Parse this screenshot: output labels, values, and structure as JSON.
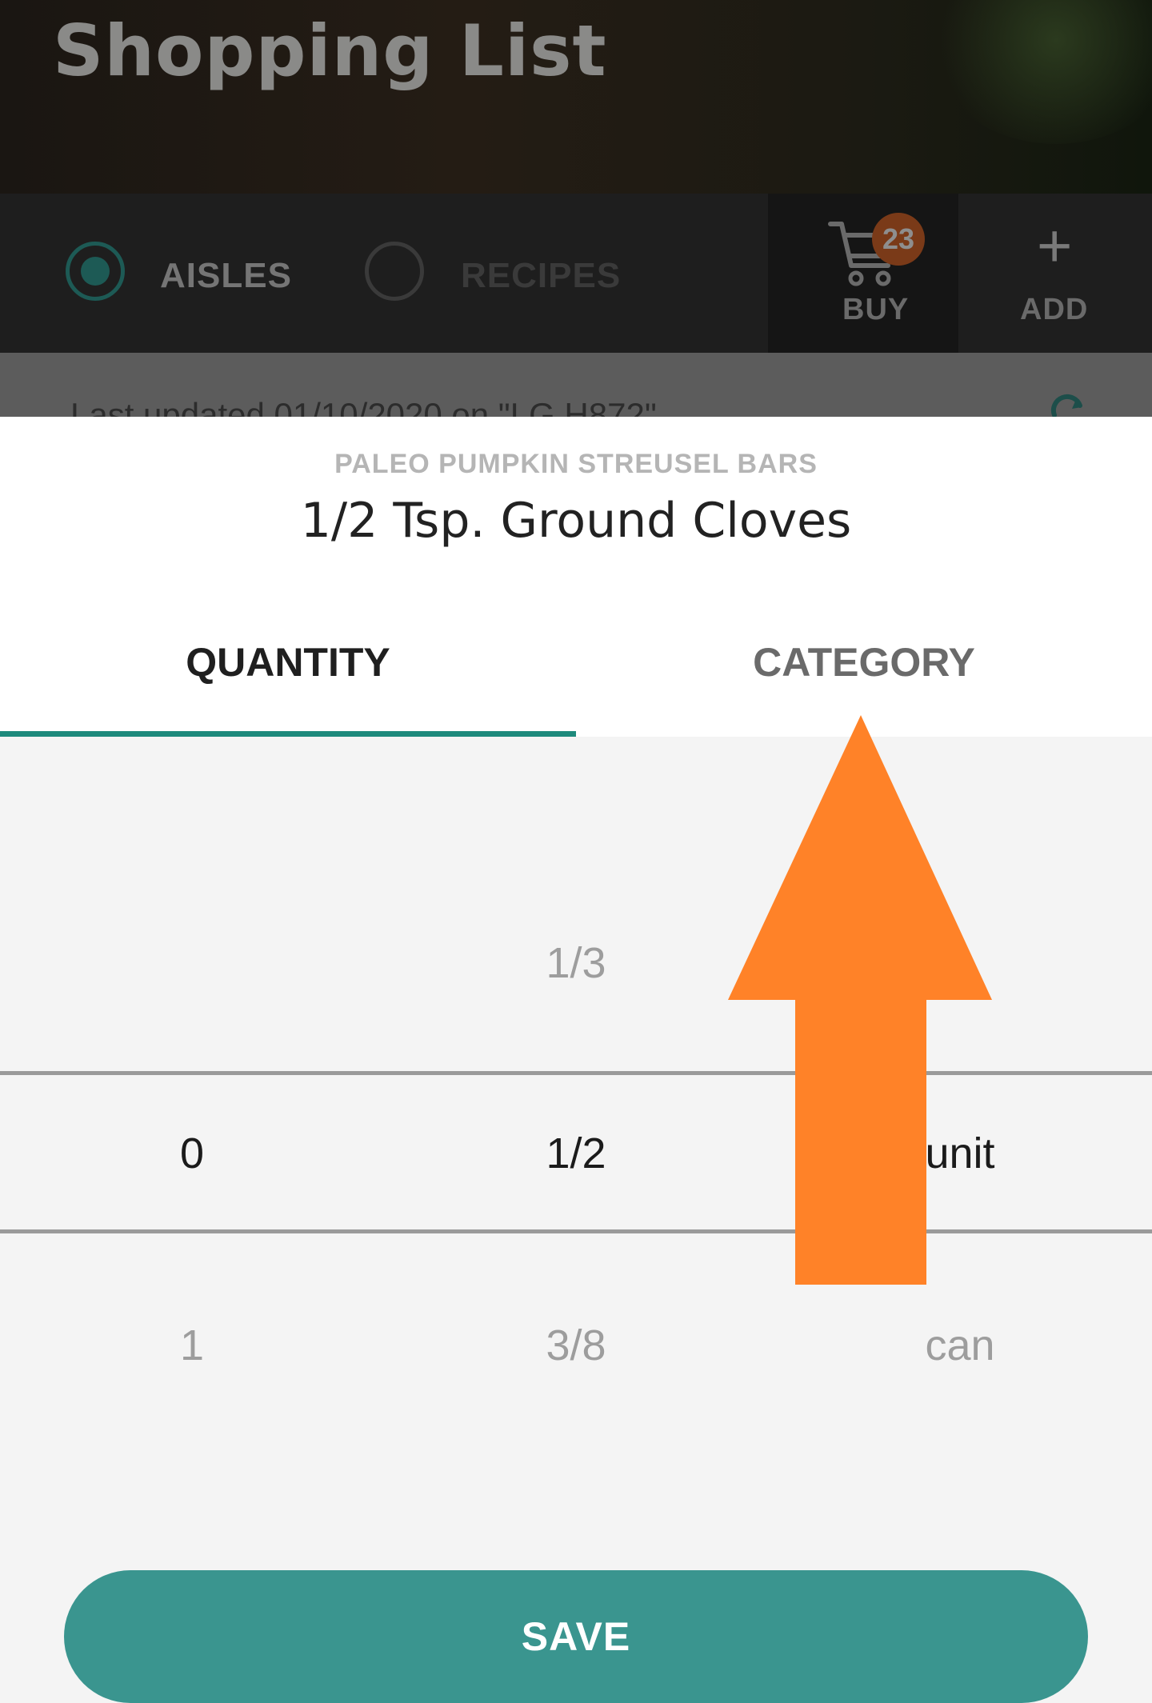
{
  "header": {
    "title": "Shopping List"
  },
  "toolbar": {
    "aisles_label": "AISLES",
    "recipes_label": "RECIPES",
    "buy_label": "BUY",
    "cart_count": "23",
    "add_label": "ADD",
    "add_icon": "plus-icon"
  },
  "status": {
    "last_updated": "Last updated 01/10/2020 on \"LG H872\""
  },
  "dialog": {
    "recipe_name": "PALEO PUMPKIN STREUSEL BARS",
    "item_name": "1/2 Tsp. Ground Cloves",
    "tabs": [
      {
        "label": "QUANTITY",
        "active": true
      },
      {
        "label": "CATEGORY",
        "active": false
      }
    ],
    "picker": {
      "whole": {
        "selected": "0",
        "next": "1"
      },
      "fraction": {
        "prev": "1/3",
        "selected": "1/2",
        "next": "3/8"
      },
      "unit": {
        "selected": "unit",
        "next": "can"
      }
    },
    "save_label": "SAVE"
  },
  "colors": {
    "accent": "#3a958f",
    "tab_indicator": "#1e8a7c",
    "arrow": "#ff8228",
    "badge": "#7a3a18"
  }
}
